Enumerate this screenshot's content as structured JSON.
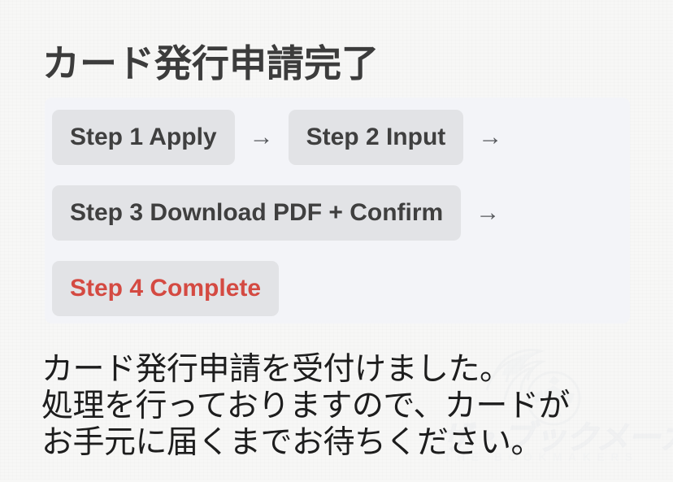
{
  "page": {
    "title": "カード発行申請完了",
    "background_color": "#f7f7f6",
    "panel_color": "#f3f4f8",
    "chip_color": "#e2e3e6",
    "text_color": "#3c3c3c",
    "accent_color": "#d44a42"
  },
  "steps": {
    "arrow_glyph": "→",
    "rows": [
      {
        "items": [
          {
            "label": "Step 1 Apply",
            "state": "done"
          },
          {
            "label": "Step 2 Input",
            "state": "done"
          }
        ],
        "trailing_arrow": true
      },
      {
        "items": [
          {
            "label": "Step 3 Download PDF + Confirm",
            "state": "done"
          }
        ],
        "trailing_arrow": true
      },
      {
        "items": [
          {
            "label": "Step 4 Complete",
            "state": "current"
          }
        ],
        "trailing_arrow": false
      }
    ]
  },
  "message": {
    "lines": [
      "カード発行申請を受付けました。",
      "処理を行っておりますので、カードが",
      "お手元に届くまでお待ちください。"
    ]
  },
  "watermark": {
    "kana": "ザ・ブックメーカーズ",
    "roman": "THE BOOKMAKERS",
    "logo": "flaming-soccer-ball-icon"
  }
}
